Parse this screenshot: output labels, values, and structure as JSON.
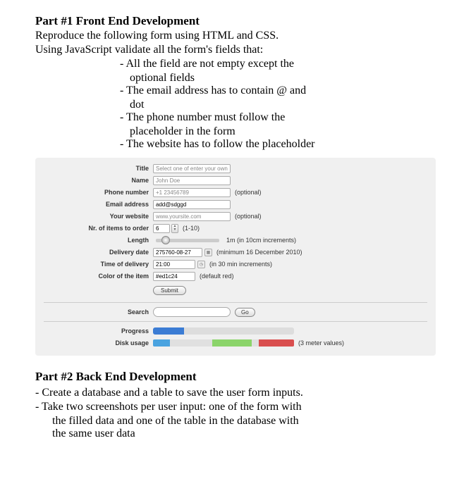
{
  "part1": {
    "heading": "Part #1 Front End Development",
    "instr1": "Reproduce the following form using HTML and CSS.",
    "instr2": "Using JavaScript validate all the form's fields that:",
    "bullets": [
      {
        "l1": "- All the field are not empty except the",
        "l2": "optional fields"
      },
      {
        "l1": "- The email address has to contain @ and",
        "l2": "dot"
      },
      {
        "l1": "- The phone number must follow the",
        "l2": "placeholder in the form"
      },
      {
        "l1": "- The website has to follow the placeholder",
        "l2": ""
      }
    ]
  },
  "form": {
    "labels": {
      "title": "Title",
      "name": "Name",
      "phone": "Phone number",
      "email": "Email address",
      "website": "Your website",
      "items": "Nr. of items to order",
      "length": "Length",
      "delivery_date": "Delivery date",
      "delivery_time": "Time of delivery",
      "color": "Color of the item",
      "search": "Search",
      "progress": "Progress",
      "disk": "Disk usage"
    },
    "values": {
      "title_ph": "Select one of enter your own",
      "name_ph": "John Doe",
      "phone_ph": "+1 23456789",
      "email_val": "add@sdggd",
      "website_ph": "www.yoursite.com",
      "items_val": "6",
      "delivery_date_val": "275760-08-27",
      "delivery_time_val": "21:00",
      "color_val": "#ed1c24"
    },
    "hints": {
      "phone": "(optional)",
      "website": "(optional)",
      "items": "(1-10)",
      "length": "1m (in 10cm increments)",
      "delivery_date": "(minimum 16 December 2010)",
      "delivery_time": "(in 30 min increments)",
      "color": "(default red)",
      "disk": "(3 meter values)"
    },
    "buttons": {
      "submit": "Submit",
      "go": "Go"
    }
  },
  "part2": {
    "heading": "Part #2 Back End Development",
    "items": [
      {
        "l1": "- Create a database and a table to save the user form inputs."
      },
      {
        "l1": "- Take two screenshots per user input: one of the form with",
        "l2": "the filled data and one of the table in the database with",
        "l3": "the same user data"
      }
    ]
  }
}
